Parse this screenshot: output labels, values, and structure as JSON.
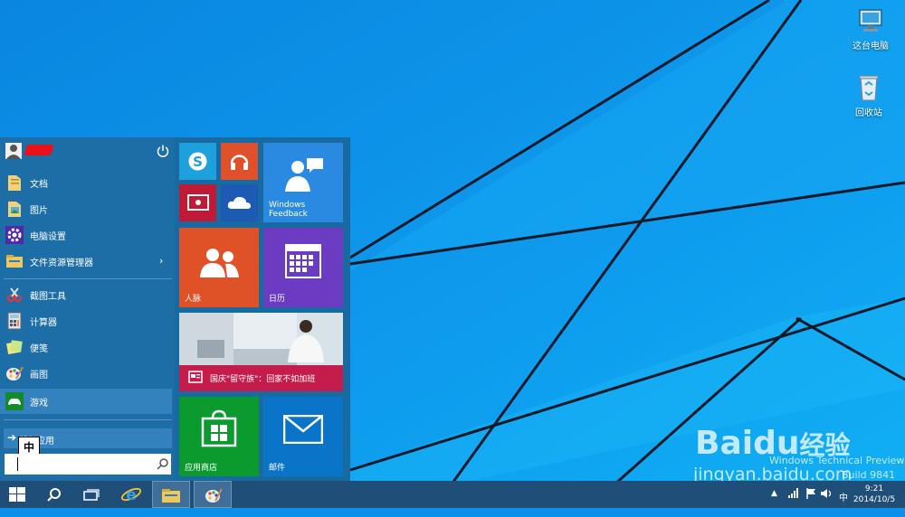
{
  "desktop": {
    "icons": [
      {
        "label": "这台电脑",
        "icon": "computer-icon"
      },
      {
        "label": "回收站",
        "icon": "recycle-bin-icon"
      }
    ]
  },
  "start_menu": {
    "user": {
      "avatar_icon": "user-avatar-icon",
      "power_icon": "power-icon"
    },
    "items": [
      {
        "label": "文档",
        "icon": "documents-folder-icon"
      },
      {
        "label": "图片",
        "icon": "pictures-folder-icon"
      },
      {
        "label": "电脑设置",
        "icon": "pc-settings-gear-icon"
      },
      {
        "label": "文件资源管理器",
        "icon": "file-explorer-icon",
        "has_submenu": true
      },
      {
        "label": "截图工具",
        "icon": "snipping-tool-icon"
      },
      {
        "label": "计算器",
        "icon": "calculator-icon"
      },
      {
        "label": "便笺",
        "icon": "sticky-notes-icon"
      },
      {
        "label": "画图",
        "icon": "paint-icon"
      },
      {
        "label": "游戏",
        "icon": "games-icon",
        "active": true
      }
    ],
    "all_apps_label": "所有应用",
    "ime_indicator": "中",
    "search": {
      "value": "",
      "icon": "search-icon"
    }
  },
  "tiles": {
    "skype": {
      "label": "",
      "color": "#1da0dc"
    },
    "music": {
      "label": "",
      "color": "#e0502b"
    },
    "video": {
      "label": "",
      "color": "#c11a37"
    },
    "onedrive": {
      "label": "",
      "color": "#1d5ab4"
    },
    "feedback": {
      "label": "Windows Feedback",
      "color": "#2a89e0"
    },
    "people": {
      "label": "人脉",
      "color": "#df5127"
    },
    "calendar": {
      "label": "日历",
      "color": "#6b3cc1"
    },
    "news": {
      "label": "国庆\"留守族\"：回家不如加班",
      "color": "#c41d4c"
    },
    "store": {
      "label": "应用商店",
      "color": "#0a9a2e"
    },
    "mail": {
      "label": "邮件",
      "color": "#0a74c8"
    }
  },
  "taskbar": {
    "buttons": [
      {
        "icon": "windows-start-icon"
      },
      {
        "icon": "search-icon"
      },
      {
        "icon": "task-view-icon"
      },
      {
        "icon": "internet-explorer-icon"
      },
      {
        "icon": "file-explorer-icon",
        "active": true
      },
      {
        "icon": "paint-icon",
        "active": true
      }
    ],
    "tray": {
      "ime": "中",
      "time": "9:21",
      "date": "2014/10/5"
    }
  },
  "watermark": {
    "brand": "Bai",
    "brand2": "du",
    "brand_cn": "经验",
    "site": "jingyan.baidu.com",
    "preview_line1": "Windows Technical Preview",
    "preview_line2": "Build 9841"
  },
  "colors": {
    "desktop_bg": "#0c8fe6",
    "start_left": "#1d6ea7",
    "start_right": "#1a6aa2",
    "taskbar": "#1f4f78"
  }
}
